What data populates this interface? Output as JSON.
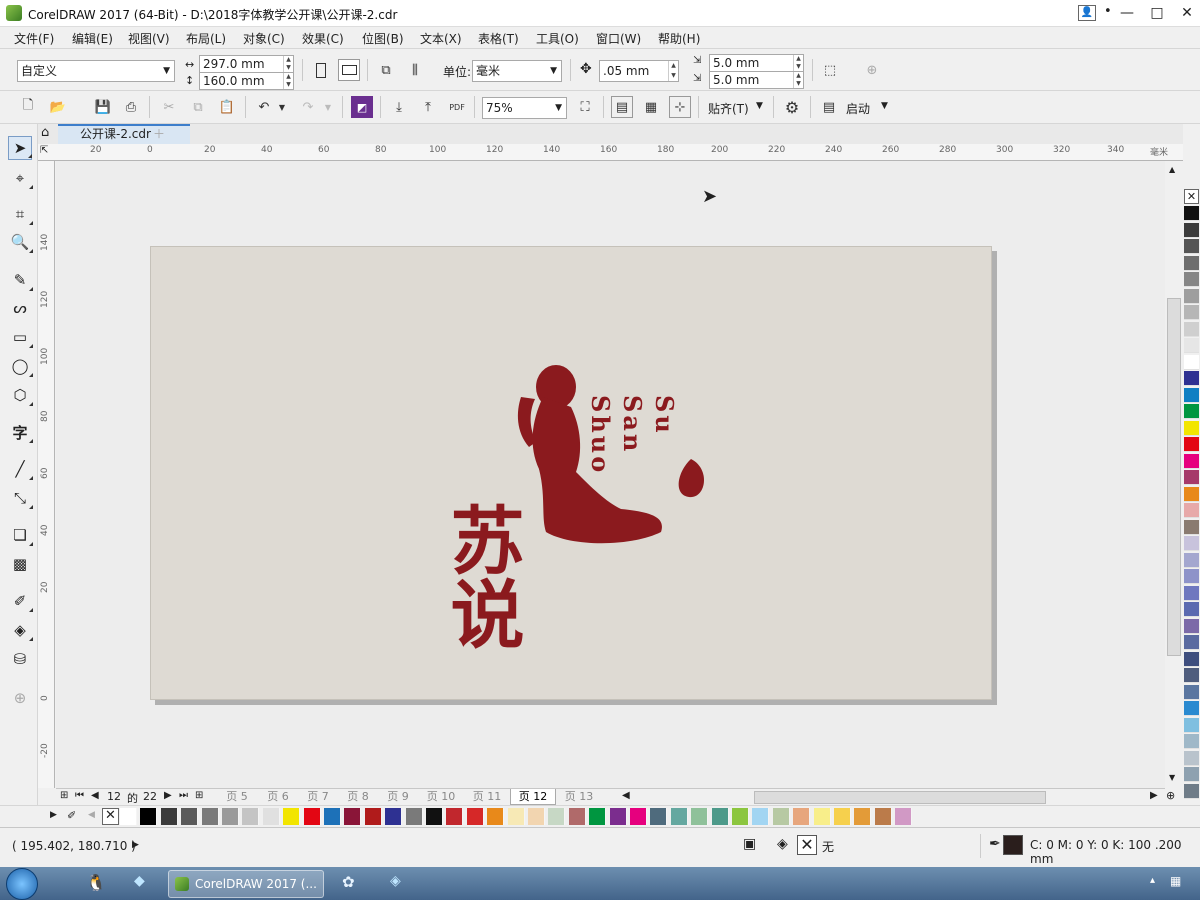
{
  "window": {
    "title": "CorelDRAW 2017 (64-Bit) - D:\\2018字体教学公开课\\公开课-2.cdr",
    "minimize": "—",
    "maximize": "□",
    "close": "✕"
  },
  "menu": [
    "文件(F)",
    "编辑(E)",
    "视图(V)",
    "布局(L)",
    "对象(C)",
    "效果(C)",
    "位图(B)",
    "文本(X)",
    "表格(T)",
    "工具(O)",
    "窗口(W)",
    "帮助(H)"
  ],
  "property_bar": {
    "preset": "自定义",
    "width": "297.0 mm",
    "height": "160.0 mm",
    "unit_label": "单位:",
    "unit_value": "毫米",
    "nudge": ".05 mm",
    "dup_x": "5.0 mm",
    "dup_y": "5.0 mm"
  },
  "standard_bar": {
    "zoom": "75%",
    "snap_label": "贴齐(T)",
    "launch_label": "启动"
  },
  "document_tab": "公开课-2.cdr",
  "ruler": {
    "h_ticks": [
      "20",
      "0",
      "20",
      "40",
      "60",
      "80",
      "100",
      "120",
      "140",
      "160",
      "180",
      "200",
      "220",
      "240",
      "260",
      "280",
      "300",
      "320",
      "340",
      "毫米"
    ],
    "v_ticks": [
      "140",
      "120",
      "100",
      "80",
      "60",
      "40",
      "20",
      "0",
      "-20"
    ]
  },
  "artwork": {
    "chinese_mark": "苏说",
    "latin_lines": [
      "Su",
      "San",
      "Shuo"
    ],
    "accent_color": "#8b1a1e",
    "paper_color": "#dedad3"
  },
  "page_nav": {
    "current": "12",
    "of_label": "的",
    "total": "22",
    "tabs": [
      "页 5",
      "页 6",
      "页 7",
      "页 8",
      "页 9",
      "页 10",
      "页 11",
      "页 12",
      "页 13"
    ],
    "active_tab": "页 12"
  },
  "status": {
    "coords": "( 195.402, 180.710 )",
    "fill_label": "无",
    "outline_info": "C: 0 M: 0 Y: 0 K: 100  .200 mm"
  },
  "taskbar": {
    "active_app": "CorelDRAW 2017 (..."
  },
  "palette_colors": [
    "#ffffff",
    "#000000",
    "#3b3b3b",
    "#5a5a5a",
    "#7a7a7a",
    "#9a9a9a",
    "#c4c4c4",
    "#e0e0e0",
    "#f2e500",
    "#e30613",
    "#1d71b8",
    "#8a1538",
    "#b01b1b",
    "#2e3192",
    "#7a7a7a",
    "#111111",
    "#c1272d",
    "#d62828",
    "#e8891a",
    "#f7e9b5",
    "#f2d5b0",
    "#c7d8c5",
    "#b06a6a",
    "#009640",
    "#7b2d8e",
    "#e6007e",
    "#4f6b7d",
    "#65a8a0",
    "#8fc19a",
    "#4d9a8a",
    "#8cc63f",
    "#a2d5f2",
    "#b7c9a3",
    "#e7a67d",
    "#f8ee8a",
    "#f6d04d",
    "#e39b38",
    "#bb7b4a",
    "#d199c5"
  ],
  "vpalette_colors": [
    "#111111",
    "#3b3b3b",
    "#555555",
    "#6e6e6e",
    "#868686",
    "#9e9e9e",
    "#b6b6b6",
    "#cfcfcf",
    "#e6e6e6",
    "#ffffff",
    "#2e3192",
    "#0f7fc3",
    "#009640",
    "#f2e500",
    "#e30613",
    "#e6007e",
    "#a63a6a",
    "#e8891a",
    "#e7a9a9",
    "#8a7b70",
    "#c8c3dc",
    "#a4a7cf",
    "#8e93c9",
    "#6f78bf",
    "#5b6ab0",
    "#7c6aa8",
    "#5a6aa0",
    "#3e4e7e",
    "#4f5d7d",
    "#5a76a0",
    "#2a8ad0",
    "#7fbfe0",
    "#9fb8c8",
    "#b9c3cc",
    "#8ea1b0",
    "#6f7c88"
  ]
}
